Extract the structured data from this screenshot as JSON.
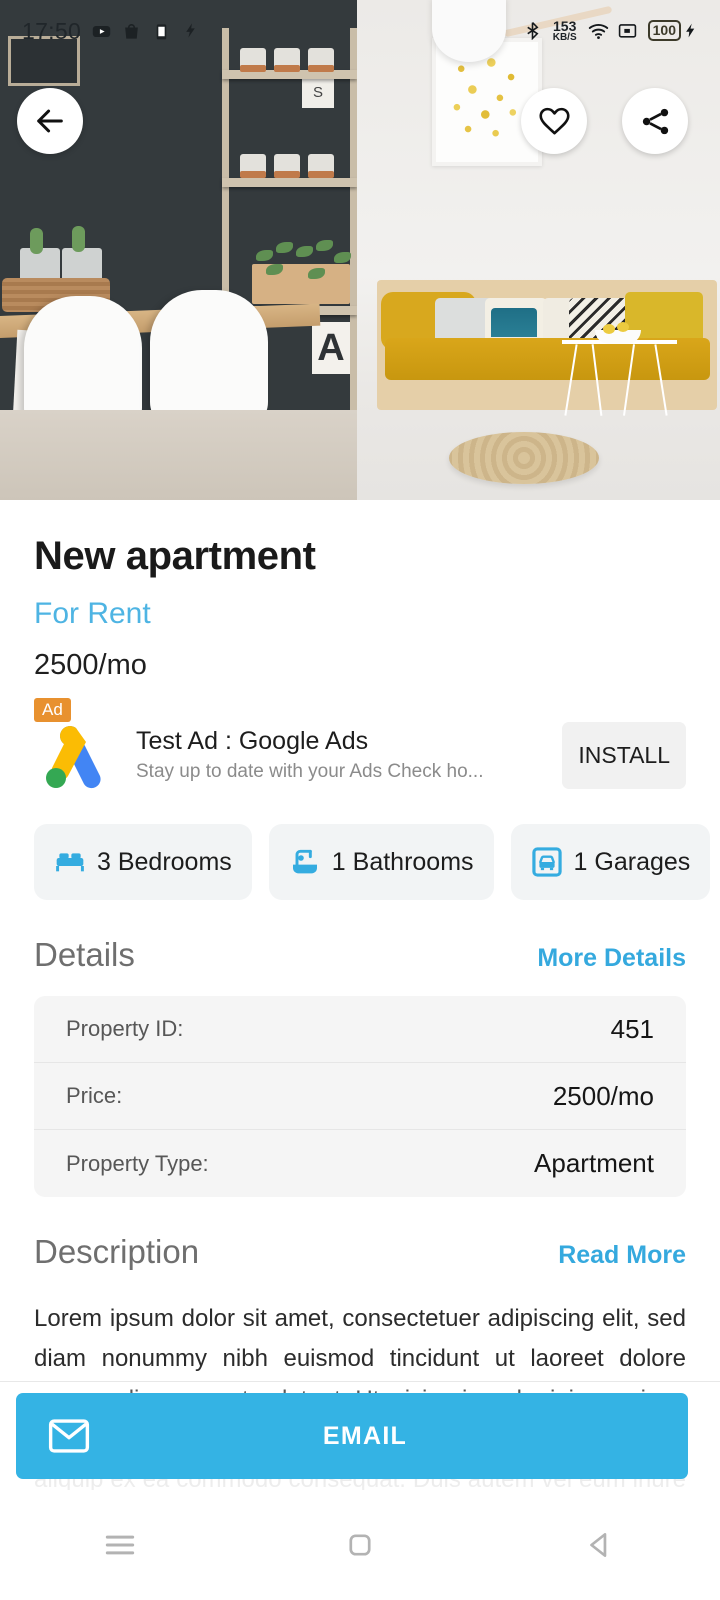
{
  "statusbar": {
    "time": "17:50",
    "notification_icons": [
      "youtube-icon",
      "shopping-bag-icon",
      "device-icon",
      "flash-icon"
    ],
    "bluetooth_icon": "bluetooth-icon",
    "network_speed_value": "153",
    "network_speed_unit": "KB/S",
    "wifi_icon": "wifi-icon",
    "cast_icon": "cast-icon",
    "battery_level": "100",
    "charging_icon": "charging-bolt-icon"
  },
  "hero": {
    "back_icon": "arrow-left-icon",
    "favorite_icon": "heart-icon",
    "share_icon": "share-icon",
    "image_alt": "apartment-interior-photo"
  },
  "listing": {
    "title": "New apartment",
    "status": "For Rent",
    "price": "2500/mo"
  },
  "ad": {
    "badge": "Ad",
    "logo_icon": "google-ads-logo",
    "title": "Test Ad : Google Ads",
    "subtitle": "Stay up to date with your Ads Check ho...",
    "cta_label": "INSTALL"
  },
  "features": [
    {
      "icon": "bed-icon",
      "label": "3 Bedrooms"
    },
    {
      "icon": "bathtub-icon",
      "label": "1 Bathrooms"
    },
    {
      "icon": "garage-icon",
      "label": "1 Garages"
    }
  ],
  "details": {
    "section_title": "Details",
    "link_label": "More Details",
    "rows": [
      {
        "key": "Property ID:",
        "value": "451"
      },
      {
        "key": "Price:",
        "value": "2500/mo"
      },
      {
        "key": "Property Type:",
        "value": "Apartment"
      }
    ]
  },
  "description": {
    "section_title": "Description",
    "link_label": "Read More",
    "body": "Lorem ipsum dolor sit amet, consectetuer adipiscing elit, sed diam nonummy nibh euismod tincidunt ut laoreet dolore magna aliquam erat volutpat. Ut wisi enim ad minim veniam, quis nostrud exerci tation ullamcorper suscipit lobortis nisl ut aliquip ex ea commodo consequat. Duis autem vel eum iriure dolor in hendrerit in vulputate velit esse molestie"
  },
  "contact": {
    "email_icon": "envelope-icon",
    "email_label": "EMAIL"
  },
  "navbar": {
    "recents_icon": "menu-icon",
    "home_icon": "home-square-icon",
    "back_icon": "back-triangle-icon"
  },
  "colors": {
    "accent": "#34b3e4",
    "link": "#35a9de",
    "ad_badge": "#e8912f",
    "chip_bg": "#f2f4f5",
    "table_bg": "#f5f5f5"
  }
}
